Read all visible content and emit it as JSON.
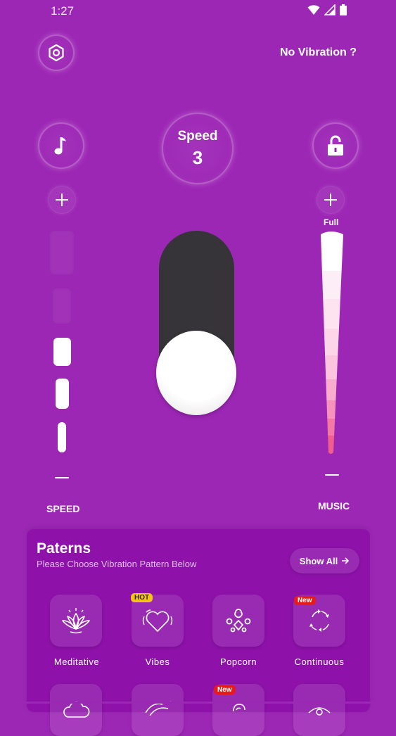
{
  "status_bar": {
    "time": "1:27"
  },
  "header": {
    "no_vibration_label": "No Vibration ?"
  },
  "speed_display": {
    "label": "Speed",
    "value": "3"
  },
  "speed_slider": {
    "label": "SPEED",
    "level": 3,
    "max_level": 5
  },
  "music_slider": {
    "label": "MUSIC",
    "top_label": "Full"
  },
  "toggle": {
    "state": "on"
  },
  "patterns": {
    "title": "Paterns",
    "subtitle": "Please Choose Vibration Pattern Below",
    "show_all_label": "Show All",
    "items": [
      {
        "label": "Meditative",
        "icon": "lotus-icon",
        "badge": ""
      },
      {
        "label": "Vibes",
        "icon": "heart-vibes-icon",
        "badge": "HOT"
      },
      {
        "label": "Popcorn",
        "icon": "popcorn-icon",
        "badge": ""
      },
      {
        "label": "Continuous",
        "icon": "refresh-cycle-icon",
        "badge": "New"
      },
      {
        "label": "",
        "icon": "cloud-icon",
        "badge": ""
      },
      {
        "label": "",
        "icon": "waves-icon",
        "badge": ""
      },
      {
        "label": "",
        "icon": "swirl-icon",
        "badge": "New"
      },
      {
        "label": "",
        "icon": "eye-icon",
        "badge": ""
      }
    ]
  },
  "colors": {
    "background": "#9d27b5",
    "panel": "#8e12aa",
    "toggle_track": "#363438",
    "badge_hot": "#f3c317",
    "badge_new": "#e61c1c"
  }
}
